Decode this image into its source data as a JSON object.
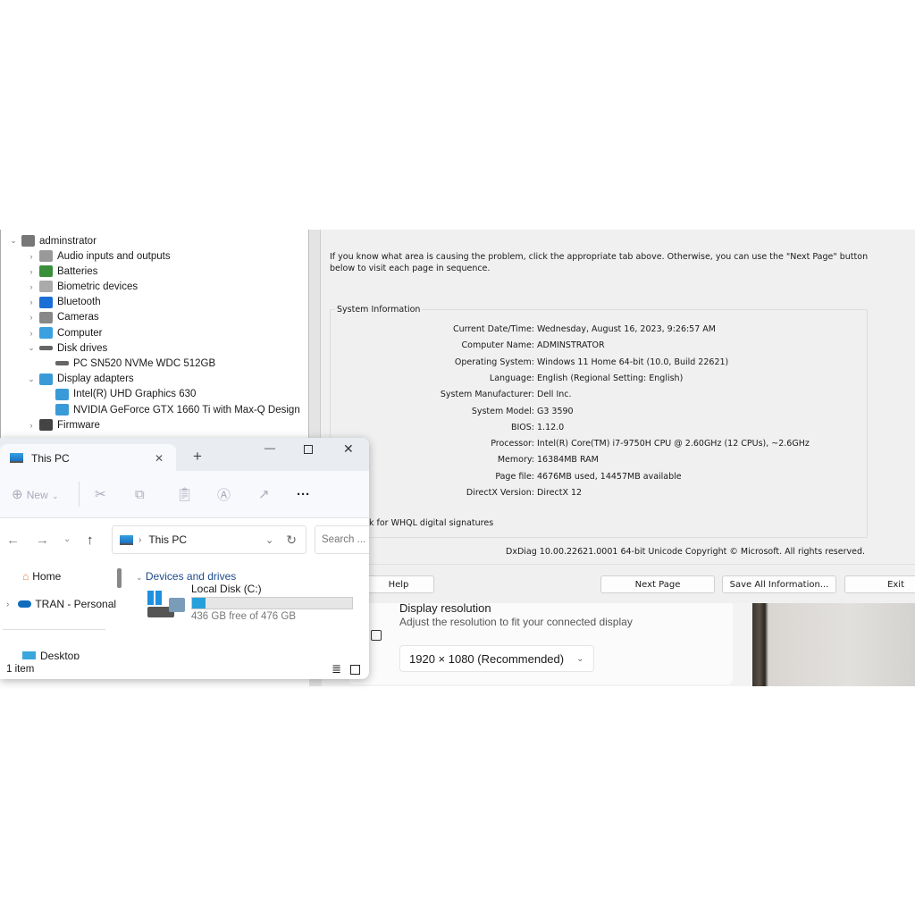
{
  "device_manager": {
    "root": "adminstrator",
    "items": [
      {
        "label": "Audio inputs and outputs",
        "level": 1,
        "expanded": false,
        "icon": "speaker-icon"
      },
      {
        "label": "Batteries",
        "level": 1,
        "expanded": false,
        "icon": "battery-icon"
      },
      {
        "label": "Biometric devices",
        "level": 1,
        "expanded": false,
        "icon": "fingerprint-icon"
      },
      {
        "label": "Bluetooth",
        "level": 1,
        "expanded": false,
        "icon": "bluetooth-icon"
      },
      {
        "label": "Cameras",
        "level": 1,
        "expanded": false,
        "icon": "camera-icon"
      },
      {
        "label": "Computer",
        "level": 1,
        "expanded": false,
        "icon": "monitor-icon"
      },
      {
        "label": "Disk drives",
        "level": 1,
        "expanded": true,
        "icon": "disk-icon"
      },
      {
        "label": "PC SN520 NVMe WDC 512GB",
        "level": 2,
        "icon": "disk-icon"
      },
      {
        "label": "Display adapters",
        "level": 1,
        "expanded": true,
        "icon": "display-adapter-icon"
      },
      {
        "label": "Intel(R) UHD Graphics 630",
        "level": 2,
        "icon": "display-adapter-icon"
      },
      {
        "label": "NVIDIA GeForce GTX 1660 Ti with Max-Q Design",
        "level": 2,
        "icon": "display-adapter-icon"
      },
      {
        "label": "Firmware",
        "level": 1,
        "expanded": false,
        "icon": "firmware-icon"
      }
    ]
  },
  "dxdiag": {
    "intro": "If you know what area is causing the problem, click the appropriate tab above.  Otherwise, you can use the \"Next Page\" button below to visit each page in sequence.",
    "group_title": "System Information",
    "rows": [
      {
        "label": "Current Date/Time:",
        "value": "Wednesday, August 16, 2023, 9:26:57 AM"
      },
      {
        "label": "Computer Name:",
        "value": "ADMINSTRATOR"
      },
      {
        "label": "Operating System:",
        "value": "Windows 11 Home 64-bit (10.0, Build 22621)"
      },
      {
        "label": "Language:",
        "value": "English (Regional Setting: English)"
      },
      {
        "label": "System Manufacturer:",
        "value": "Dell Inc."
      },
      {
        "label": "System Model:",
        "value": "G3 3590"
      },
      {
        "label": "BIOS:",
        "value": "1.12.0"
      },
      {
        "label": "Processor:",
        "value": "Intel(R) Core(TM) i7-9750H CPU @ 2.60GHz (12 CPUs), ~2.6GHz"
      },
      {
        "label": "Memory:",
        "value": "16384MB RAM"
      },
      {
        "label": "Page file:",
        "value": "4676MB used, 14457MB available"
      },
      {
        "label": "DirectX Version:",
        "value": "DirectX 12"
      }
    ],
    "whql_partial": "k for WHQL digital signatures",
    "footer": "DxDiag 10.00.22621.0001 64-bit Unicode  Copyright © Microsoft. All rights reserved.",
    "buttons": {
      "help": "Help",
      "next": "Next Page",
      "save": "Save All Information...",
      "exit": "Exit"
    }
  },
  "settings": {
    "title": "Display resolution",
    "subtitle": "Adjust the resolution to fit your connected display",
    "resolution": "1920 × 1080 (Recommended)"
  },
  "explorer": {
    "tab_title": "This PC",
    "new_label": "New",
    "breadcrumb": "This PC",
    "search_placeholder": "Search ...",
    "nav": [
      {
        "label": "Home"
      },
      {
        "label": "TRAN - Personal"
      },
      {
        "label": "Desktop"
      }
    ],
    "section": "Devices and drives",
    "drive": {
      "name": "Local Disk (C:)",
      "free": "436 GB free of 476 GB",
      "used_fraction": 0.084
    },
    "status": "1 item",
    "accent": "#26a0da"
  }
}
